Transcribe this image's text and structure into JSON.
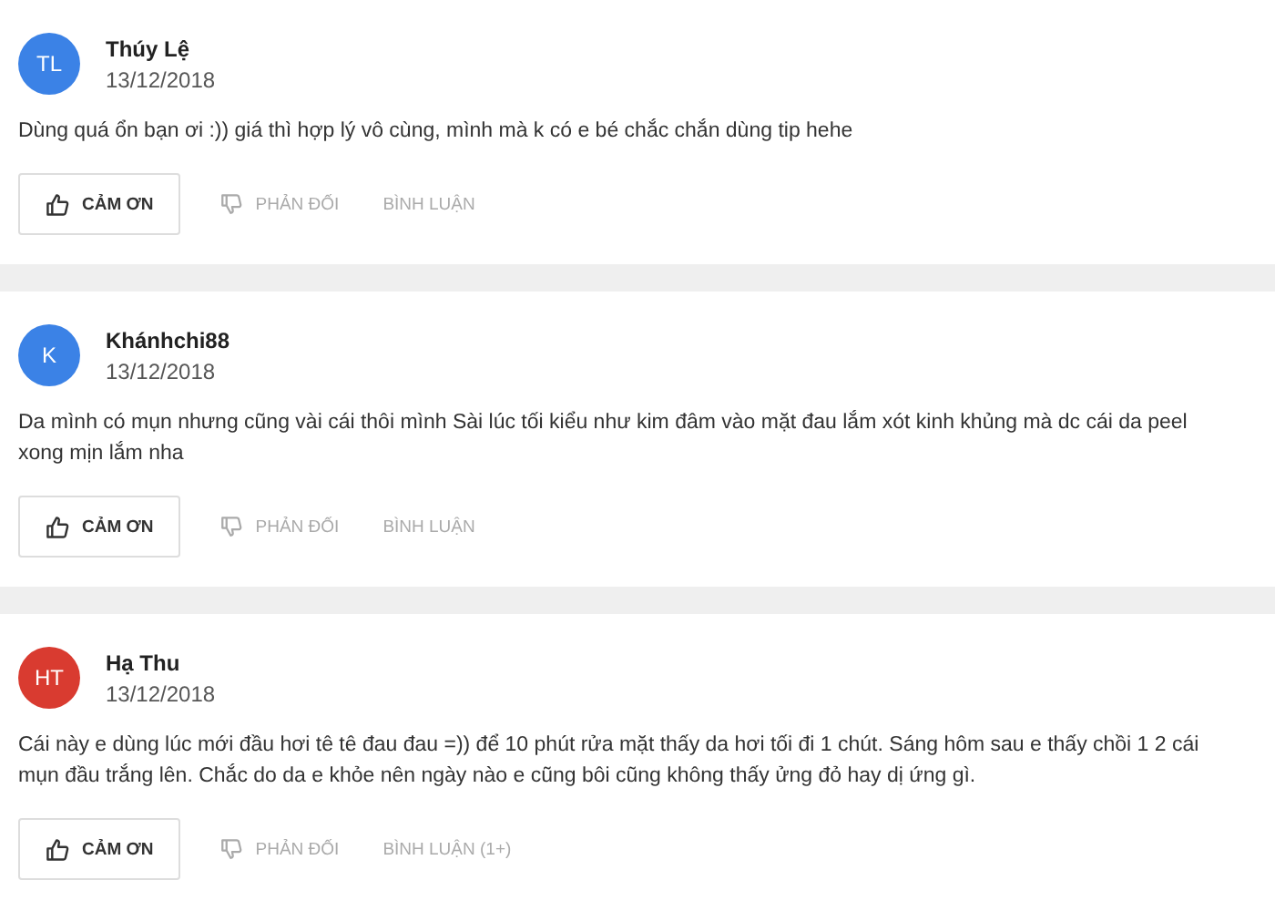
{
  "reviews": [
    {
      "initials": "TL",
      "color": "#3b82e6",
      "name": "Thúy Lệ",
      "date": "13/12/2018",
      "text": "Dùng quá ổn bạn ơi :)) giá thì hợp lý vô cùng, mình mà k có e bé chắc chắn dùng tip hehe",
      "thanks": "CẢM ƠN",
      "oppose": "PHẢN ĐỐI",
      "comment": "BÌNH LUẬN"
    },
    {
      "initials": "K",
      "color": "#3b82e6",
      "name": "Khánhchi88",
      "date": "13/12/2018",
      "text": "Da mình có mụn nhưng cũng vài cái thôi mình Sài lúc tối kiểu như kim đâm vào mặt đau lắm xót kinh khủng mà dc cái da peel xong mịn lắm nha",
      "thanks": "CẢM ƠN",
      "oppose": "PHẢN ĐỐI",
      "comment": "BÌNH LUẬN"
    },
    {
      "initials": "HT",
      "color": "#d93b30",
      "name": "Hạ Thu",
      "date": "13/12/2018",
      "text": "Cái này e dùng lúc mới đầu hơi tê tê đau đau =)) để 10 phút rửa mặt thấy da hơi tối đi 1 chút. Sáng hôm sau e thấy chồi 1 2 cái mụn đầu trắng lên. Chắc do da e khỏe nên ngày nào e cũng bôi cũng không thấy ửng đỏ hay dị ứng gì.",
      "thanks": "CẢM ƠN",
      "oppose": "PHẢN ĐỐI",
      "comment": "BÌNH LUẬN (1+)"
    }
  ]
}
